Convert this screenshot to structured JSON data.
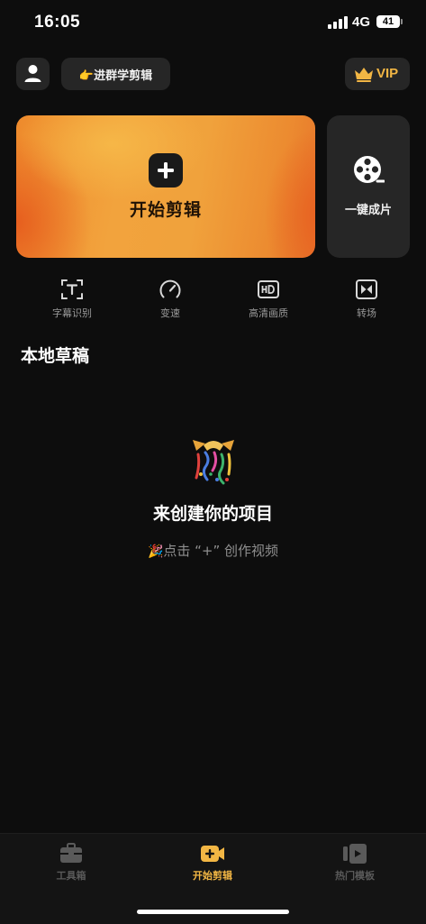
{
  "status_bar": {
    "time": "16:05",
    "network": "4G",
    "battery": "41"
  },
  "header": {
    "avatar_icon": "user-icon",
    "group_button_label": "👉进群学剪辑",
    "vip_label": "VIP",
    "vip_icon": "crown-icon",
    "vip_color": "#f2b644"
  },
  "cards": {
    "start_edit_label": "开始剪辑",
    "one_click_label": "一键成片"
  },
  "tools": [
    {
      "label": "字幕识别",
      "icon": "text-recognition-icon"
    },
    {
      "label": "变速",
      "icon": "speed-gauge-icon"
    },
    {
      "label": "高清画质",
      "icon": "hd-icon"
    },
    {
      "label": "转场",
      "icon": "transition-icon"
    }
  ],
  "drafts": {
    "title": "本地草稿",
    "empty_title": "来创建你的项目",
    "empty_hint_emoji": "🎉",
    "empty_hint": "点击 “+” 创作视频"
  },
  "tab_bar": {
    "active_color": "#f2b644",
    "inactive_color": "#5a5a5a",
    "tabs": [
      {
        "label": "工具箱",
        "icon": "toolbox-icon",
        "active": false
      },
      {
        "label": "开始剪辑",
        "icon": "video-plus-icon",
        "active": true
      },
      {
        "label": "热门模板",
        "icon": "template-icon",
        "active": false
      }
    ]
  }
}
